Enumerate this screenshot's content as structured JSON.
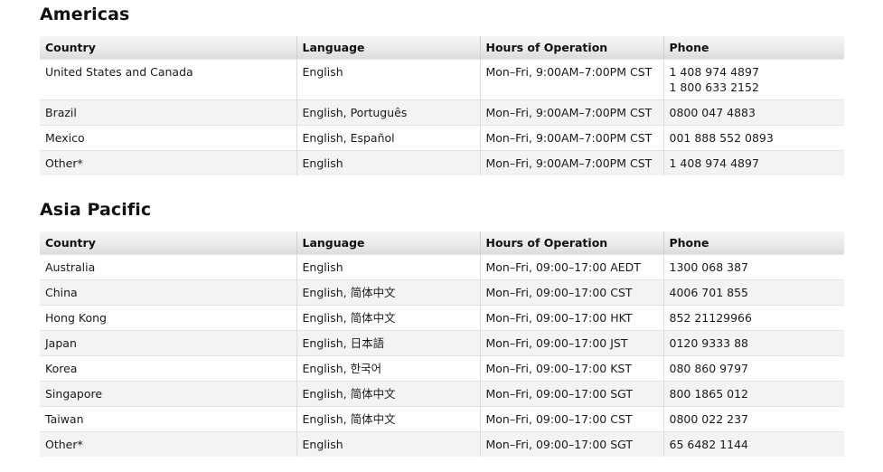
{
  "sections": [
    {
      "title": "Americas",
      "headers": [
        "Country",
        "Language",
        "Hours of Operation",
        "Phone"
      ],
      "rows": [
        {
          "country": "United States and Canada",
          "language": "English",
          "hours": "Mon–Fri, 9:00AM–7:00PM CST",
          "phones": [
            "1 408 974 4897",
            "1 800 633 2152"
          ]
        },
        {
          "country": "Brazil",
          "language": "English, Português",
          "hours": "Mon–Fri, 9:00AM–7:00PM CST",
          "phones": [
            "0800 047 4883"
          ]
        },
        {
          "country": "Mexico",
          "language": "English, Español",
          "hours": "Mon–Fri, 9:00AM–7:00PM CST",
          "phones": [
            "001 888 552 0893"
          ]
        },
        {
          "country": "Other*",
          "language": "English",
          "hours": "Mon–Fri, 9:00AM–7:00PM CST",
          "phones": [
            "1 408 974 4897"
          ]
        }
      ]
    },
    {
      "title": "Asia Pacific",
      "headers": [
        "Country",
        "Language",
        "Hours of Operation",
        "Phone"
      ],
      "rows": [
        {
          "country": "Australia",
          "language": "English",
          "hours": "Mon–Fri, 09:00–17:00 AEDT",
          "phones": [
            "1300 068 387"
          ]
        },
        {
          "country": "China",
          "language": "English, 简体中文",
          "hours": "Mon–Fri, 09:00–17:00 CST",
          "phones": [
            "4006 701 855"
          ]
        },
        {
          "country": "Hong Kong",
          "language": "English, 简体中文",
          "hours": "Mon–Fri, 09:00–17:00 HKT",
          "phones": [
            "852 21129966"
          ]
        },
        {
          "country": "Japan",
          "language": "English, 日本語",
          "hours": "Mon–Fri, 09:00–17:00 JST",
          "phones": [
            "0120 9333 88"
          ]
        },
        {
          "country": "Korea",
          "language": "English, 한국어",
          "hours": "Mon–Fri, 09:00–17:00 KST",
          "phones": [
            "080 860 9797"
          ]
        },
        {
          "country": "Singapore",
          "language": "English, 简体中文",
          "hours": "Mon–Fri, 09:00–17:00 SGT",
          "phones": [
            "800 1865 012"
          ]
        },
        {
          "country": "Taiwan",
          "language": "English, 简体中文",
          "hours": "Mon–Fri, 09:00–17:00 CST",
          "phones": [
            "0800 022 237"
          ]
        },
        {
          "country": "Other*",
          "language": "English",
          "hours": "Mon–Fri, 09:00–17:00 SGT",
          "phones": [
            "65 6482 1144"
          ]
        }
      ]
    }
  ],
  "colors": {
    "row_alt": "#f3f3f3",
    "header_bg": "#e9e9e9",
    "text": "#1a1a1a"
  }
}
